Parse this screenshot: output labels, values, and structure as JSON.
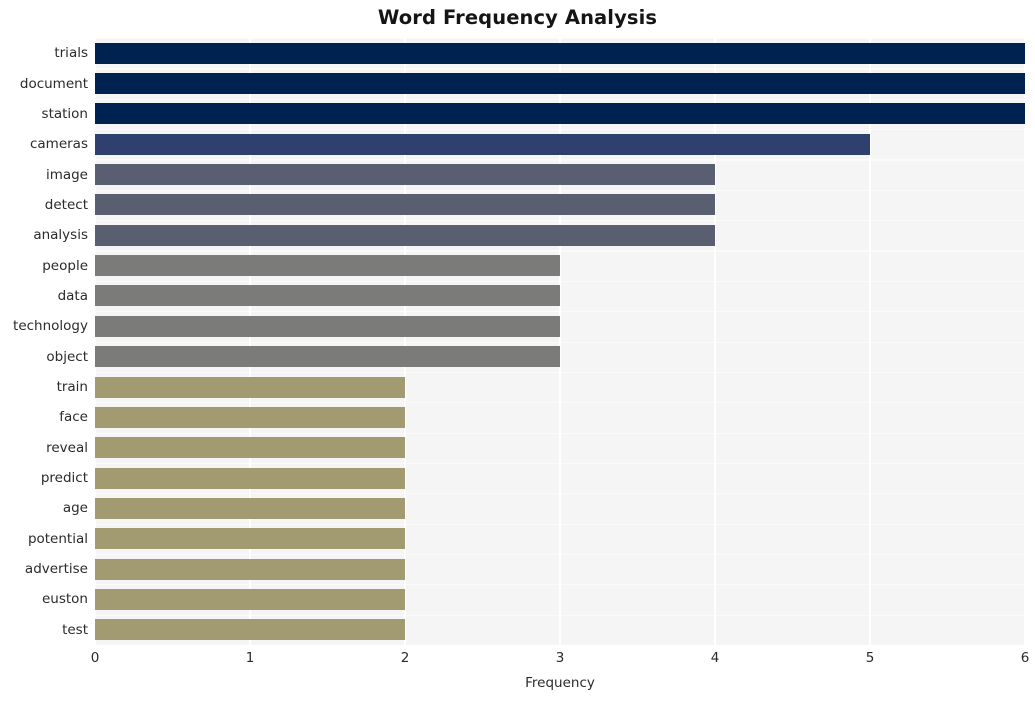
{
  "chart_data": {
    "type": "bar",
    "orientation": "horizontal",
    "title": "Word Frequency Analysis",
    "xlabel": "Frequency",
    "ylabel": "",
    "categories": [
      "trials",
      "document",
      "station",
      "cameras",
      "image",
      "detect",
      "analysis",
      "people",
      "data",
      "technology",
      "object",
      "train",
      "face",
      "reveal",
      "predict",
      "age",
      "potential",
      "advertise",
      "euston",
      "test"
    ],
    "values": [
      6,
      6,
      6,
      5,
      4,
      4,
      4,
      3,
      3,
      3,
      3,
      2,
      2,
      2,
      2,
      2,
      2,
      2,
      2,
      2
    ],
    "bar_colors": [
      "#002251",
      "#002251",
      "#002251",
      "#2f3f6e",
      "#595e71",
      "#595e71",
      "#595e71",
      "#7b7b79",
      "#7b7b79",
      "#7b7b79",
      "#7b7b79",
      "#a29a71",
      "#a29a71",
      "#a29a71",
      "#a29a71",
      "#a29a71",
      "#a29a71",
      "#a29a71",
      "#a29a71",
      "#a29a71"
    ],
    "xlim": [
      0,
      6
    ],
    "xticks": [
      0,
      1,
      2,
      3,
      4,
      5,
      6
    ],
    "xtick_labels": [
      "0",
      "1",
      "2",
      "3",
      "4",
      "5",
      "6"
    ],
    "grid": true,
    "grid_color": "#ffffff",
    "plot_background": "#f5f5f6",
    "figure_background": "#ffffff",
    "legend": null
  }
}
